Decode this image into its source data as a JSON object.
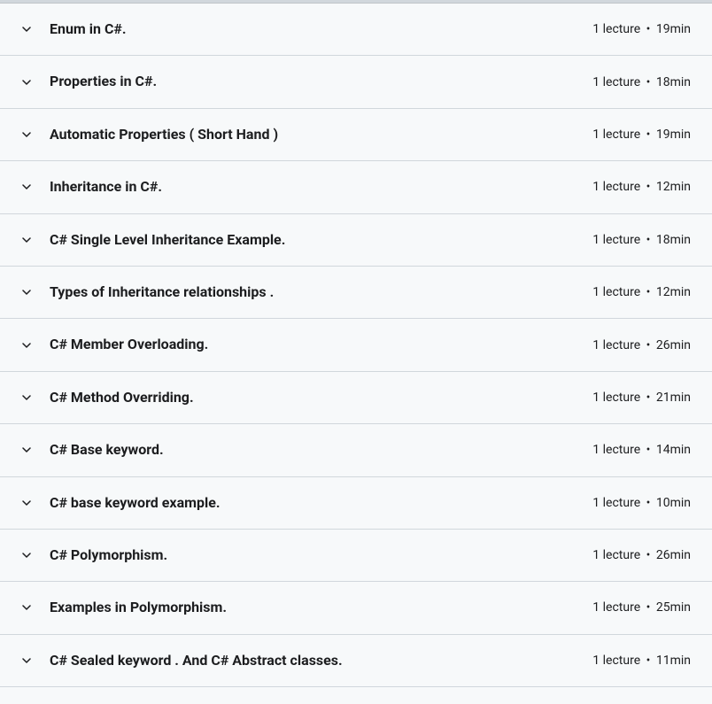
{
  "sections": [
    {
      "title": "Enum in C#.",
      "lectures": "1 lecture",
      "duration": "19min"
    },
    {
      "title": "Properties in C#.",
      "lectures": "1 lecture",
      "duration": "18min"
    },
    {
      "title": "Automatic Properties ( Short Hand )",
      "lectures": "1 lecture",
      "duration": "19min"
    },
    {
      "title": "Inheritance in C#.",
      "lectures": "1 lecture",
      "duration": "12min"
    },
    {
      "title": "C# Single Level Inheritance Example.",
      "lectures": "1 lecture",
      "duration": "18min"
    },
    {
      "title": "Types of Inheritance relationships .",
      "lectures": "1 lecture",
      "duration": "12min"
    },
    {
      "title": "C# Member Overloading.",
      "lectures": "1 lecture",
      "duration": "26min"
    },
    {
      "title": "C# Method Overriding.",
      "lectures": "1 lecture",
      "duration": "21min"
    },
    {
      "title": "C# Base keyword.",
      "lectures": "1 lecture",
      "duration": "14min"
    },
    {
      "title": "C# base keyword example.",
      "lectures": "1 lecture",
      "duration": "10min"
    },
    {
      "title": "C# Polymorphism.",
      "lectures": "1 lecture",
      "duration": "26min"
    },
    {
      "title": "Examples in Polymorphism.",
      "lectures": "1 lecture",
      "duration": "25min"
    },
    {
      "title": "C# Sealed keyword . And C# Abstract classes.",
      "lectures": "1 lecture",
      "duration": "11min"
    }
  ],
  "separator": "•"
}
